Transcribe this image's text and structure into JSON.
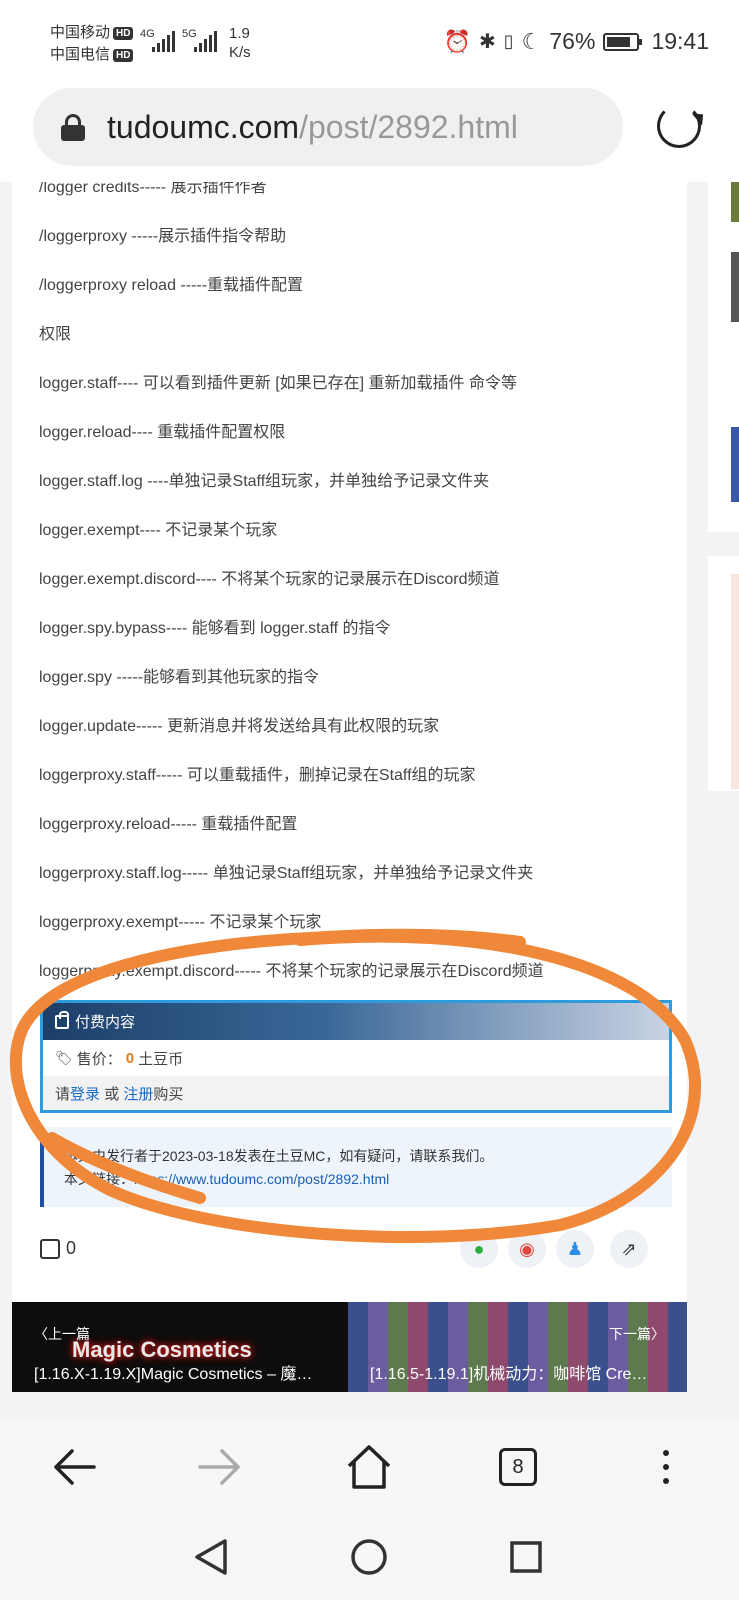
{
  "status_bar": {
    "carrier1": "中国移动",
    "carrier2": "中国电信",
    "hd": "HD",
    "net1": "4G",
    "net2": "5G",
    "speed_value": "1.9",
    "speed_unit": "K/s",
    "battery_percent": "76%",
    "time": "19:41"
  },
  "address_bar": {
    "domain": "tudoumc.com",
    "path": "/post/2892.html"
  },
  "article": {
    "commands": [
      "/logger credits----- 展示插件作者",
      "/loggerproxy -----展示插件指令帮助",
      "/loggerproxy reload -----重载插件配置",
      "权限",
      "logger.staff---- 可以看到插件更新 [如果已存在] 重新加载插件 命令等",
      "logger.reload---- 重载插件配置权限",
      "logger.staff.log ----单独记录Staff组玩家，并单独给予记录文件夹",
      "logger.exempt---- 不记录某个玩家",
      "logger.exempt.discord---- 不将某个玩家的记录展示在Discord频道",
      "logger.spy.bypass---- 能够看到 logger.staff 的指令",
      "logger.spy -----能够看到其他玩家的指令",
      "logger.update----- 更新消息并将发送给具有此权限的玩家",
      "loggerproxy.staff----- 可以重载插件，删掉记录在Staff组的玩家",
      "loggerproxy.reload----- 重载插件配置",
      "loggerproxy.staff.log----- 单独记录Staff组玩家，并单独给予记录文件夹",
      "loggerproxy.exempt----- 不记录某个玩家",
      "loggerproxy.exempt.discord----- 不将某个玩家的记录展示在Discord频道"
    ]
  },
  "paid": {
    "title": "付费内容",
    "price_label": "售价：",
    "price_value": "0",
    "price_unit": "土豆币",
    "buy_prefix": "请",
    "login": "登录",
    "or": " 或 ",
    "register": "注册",
    "buy_suffix": "购买"
  },
  "notice": {
    "line1": "本文由发行者于2023-03-18发表在土豆MC，如有疑问，请联系我们。",
    "line2_label": "本文链接：",
    "line2_url": "https://www.tudoumc.com/post/2892.html"
  },
  "actions": {
    "like_count": "0"
  },
  "post_nav": {
    "prev_label": "〈上一篇",
    "prev_title": "[1.16.X-1.19.X]Magic Cosmetics – 魔…",
    "prev_image_text": "Magic Cosmetics",
    "next_label": "下一篇〉",
    "next_title": "[1.16.5-1.19.1]机械动力：咖啡馆 Cre…"
  },
  "browser_bar": {
    "tab_count": "8"
  },
  "annotation_color": "#f0883a"
}
